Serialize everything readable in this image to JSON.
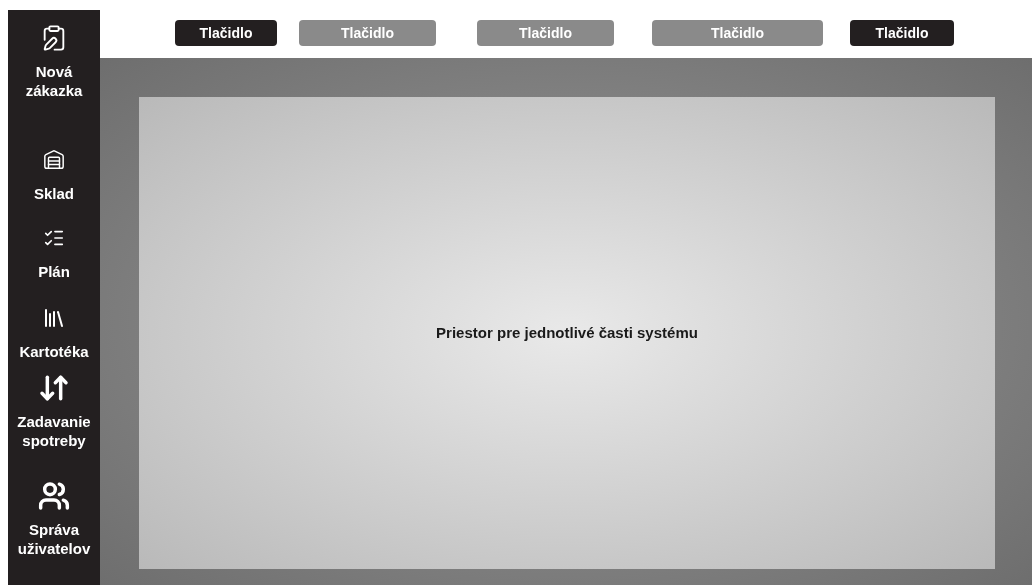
{
  "sidebar": {
    "items": [
      {
        "label": "Nová zákazka"
      },
      {
        "label": "Sklad"
      },
      {
        "label": "Plán"
      },
      {
        "label": "Kartotéka"
      },
      {
        "label": "Zadavanie spotreby"
      },
      {
        "label": "Správa uživatelov"
      }
    ]
  },
  "toolbar": {
    "buttons": [
      {
        "label": "Tlačidlo",
        "kind": "dark"
      },
      {
        "label": "Tlačidlo",
        "kind": "grey"
      },
      {
        "label": "Tlačidlo",
        "kind": "grey"
      },
      {
        "label": "Tlačidlo",
        "kind": "grey"
      },
      {
        "label": "Tlačidlo",
        "kind": "dark"
      }
    ]
  },
  "content": {
    "text": "Priestor pre jednotlivé časti systému"
  }
}
